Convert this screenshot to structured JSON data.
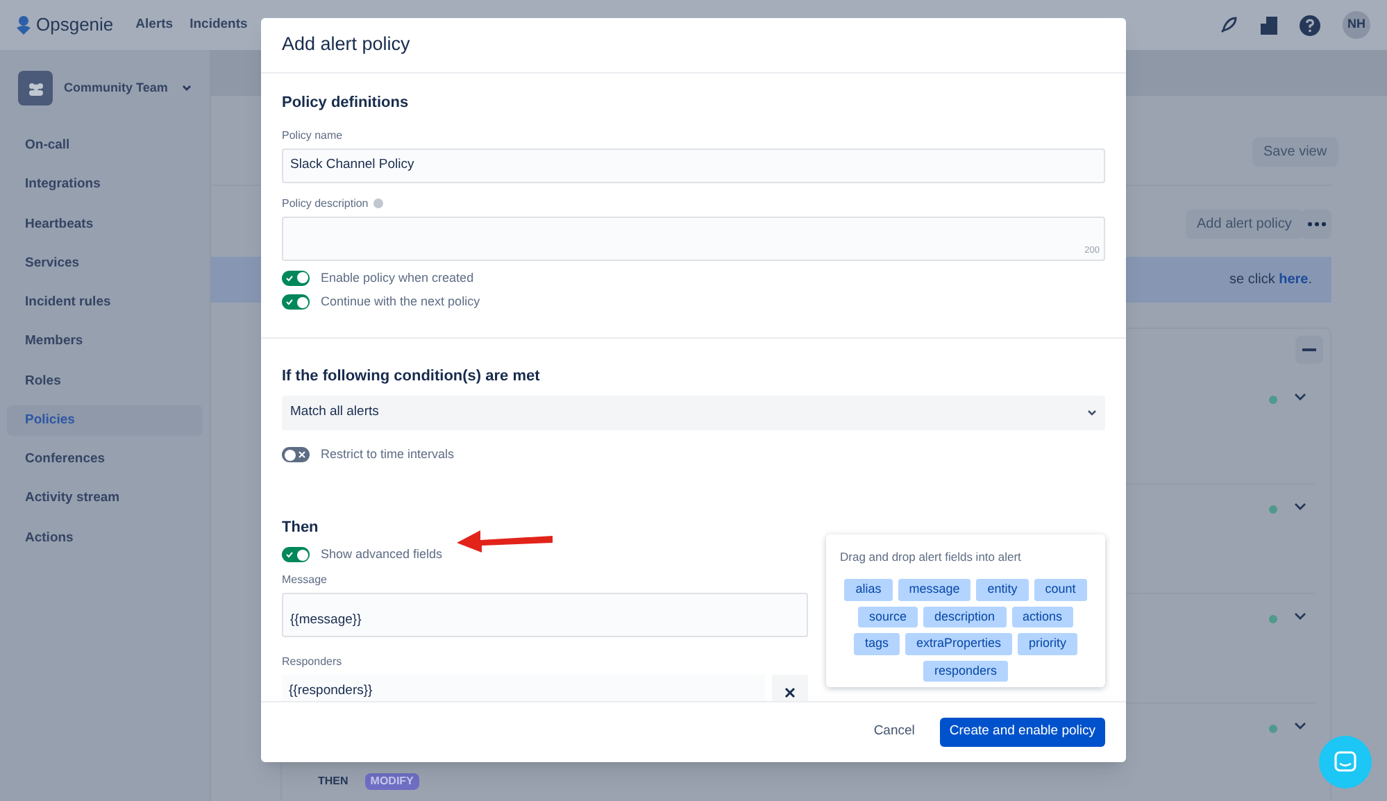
{
  "top_nav": {
    "logo": "Opsgenie",
    "links": [
      "Alerts",
      "Incidents"
    ],
    "avatar": "NH"
  },
  "sidebar": {
    "team": "Community Team",
    "items": [
      {
        "label": "On-call",
        "selected": false
      },
      {
        "label": "Integrations",
        "selected": false
      },
      {
        "label": "Heartbeats",
        "selected": false
      },
      {
        "label": "Services",
        "selected": false
      },
      {
        "label": "Incident rules",
        "selected": false
      },
      {
        "label": "Members",
        "selected": false
      },
      {
        "label": "Roles",
        "selected": false
      },
      {
        "label": "Policies",
        "selected": true
      },
      {
        "label": "Conferences",
        "selected": false
      },
      {
        "label": "Activity stream",
        "selected": false
      },
      {
        "label": "Actions",
        "selected": false
      }
    ]
  },
  "main": {
    "save_view": "Save view",
    "add_button": "Add alert policy",
    "banner": "se click **here**.",
    "then_label": "THEN",
    "action_tag": "MODIFY"
  },
  "dialog": {
    "title": "Add alert policy",
    "definitions": {
      "heading": "Policy definitions",
      "name_label": "Policy name",
      "name_value": "Slack Channel Policy",
      "description_label": "Policy description",
      "char_count": "200",
      "toggles": [
        {
          "label": "Enable policy when created",
          "on": true
        },
        {
          "label": "Continue with the next policy",
          "on": true
        }
      ]
    },
    "conditions": {
      "heading": "If the following condition(s) are met",
      "match": "Match all alerts",
      "toggles": [
        {
          "label": "Restrict to time intervals",
          "on": false
        }
      ]
    },
    "then": {
      "heading": "Then",
      "toggles": [
        {
          "label": "Show advanced fields",
          "on": true
        }
      ],
      "message_label": "Message",
      "message_value": "{{message}}",
      "responders_label": "Responders",
      "responders_value": "{{responders}}"
    },
    "fields_panel": {
      "title": "Drag and drop alert fields into alert",
      "chips": [
        "alias",
        "message",
        "entity",
        "count",
        "source",
        "description",
        "actions",
        "tags",
        "extraProperties",
        "priority",
        "responders"
      ]
    },
    "cancel": "Cancel",
    "submit": "Create and enable policy"
  }
}
